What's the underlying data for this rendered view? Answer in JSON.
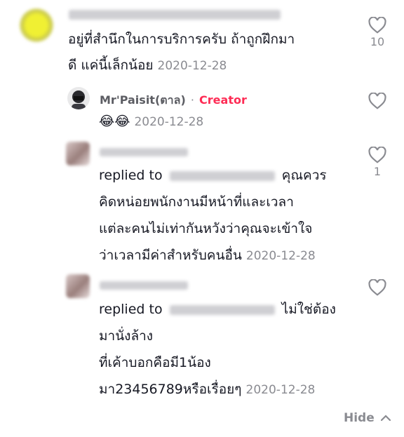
{
  "comment1": {
    "line1": "อยู่ที่สำนึกในการบริการครับ ถ้าถูกฝึกมา",
    "line2": "ดี แค่นี้เล็กน้อย",
    "date": "2020-12-28",
    "likes": "10"
  },
  "reply_creator": {
    "username": "Mr'Paisit(ตาล)",
    "separator": "·",
    "badge": "Creator",
    "emoji": "😂😂",
    "date": "2020-12-28"
  },
  "reply2": {
    "replied_to_label": "replied to",
    "line1_tail": "คุณควร",
    "line2": "คิดหน่อยพนักงานมีหน้าที่และเวลา",
    "line3": "แต่ละคนไม่เท่ากันหวังว่าคุณจะเข้าใจ",
    "line4": "ว่าเวลามีค่าสำหรับคนอื่น",
    "date": "2020-12-28",
    "likes": "1"
  },
  "reply3": {
    "replied_to_label": "replied to",
    "line1_tail": "ไม่ใช่ต้อง",
    "line2": "มานั่งล้าง",
    "line3": "ที่เค้าบอกคือมี1น้อง",
    "line4": "มา23456789หรือเรื่อยๆ",
    "date": "2020-12-28"
  },
  "footer": {
    "hide_label": "Hide"
  },
  "colors": {
    "creator": "#fe2c55",
    "muted": "#8a8b91",
    "text": "#161823"
  }
}
